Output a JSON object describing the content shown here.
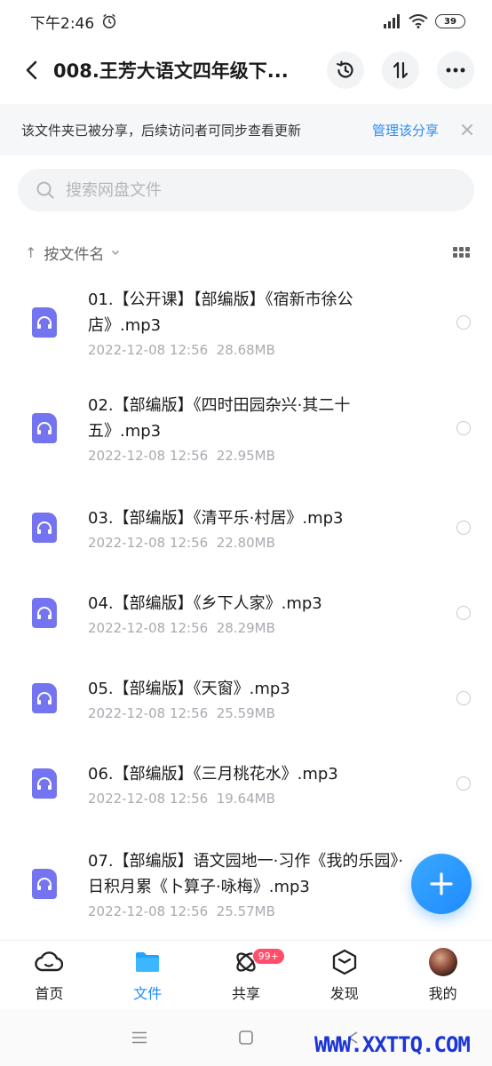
{
  "status_bar": {
    "time": "下午2:46",
    "battery": "39"
  },
  "header": {
    "title": "008.王芳大语文四年级下..."
  },
  "banner": {
    "text": "该文件夹已被分享，后续访问者可同步查看更新",
    "link": "管理该分享"
  },
  "search": {
    "placeholder": "搜索网盘文件"
  },
  "sort": {
    "arrow": "↑",
    "label": "按文件名"
  },
  "files": [
    {
      "name": "01.【公开课】【部编版】《宿新市徐公店》.mp3",
      "date": "2022-12-08  12:56",
      "size": "28.68MB"
    },
    {
      "name": "02.【部编版】《四时田园杂兴·其二十五》.mp3",
      "date": "2022-12-08  12:56",
      "size": "22.95MB"
    },
    {
      "name": "03.【部编版】《清平乐·村居》.mp3",
      "date": "2022-12-08  12:56",
      "size": "22.80MB"
    },
    {
      "name": "04.【部编版】《乡下人家》.mp3",
      "date": "2022-12-08  12:56",
      "size": "28.29MB"
    },
    {
      "name": "05.【部编版】《天窗》.mp3",
      "date": "2022-12-08  12:56",
      "size": "25.59MB"
    },
    {
      "name": "06.【部编版】《三月桃花水》.mp3",
      "date": "2022-12-08  12:56",
      "size": "19.64MB"
    },
    {
      "name": "07.【部编版】语文园地一·习作《我的乐园》·日积月累《卜算子·咏梅》.mp3",
      "date": "2022-12-08  12:56",
      "size": "25.57MB"
    }
  ],
  "nav": {
    "home": "首页",
    "files": "文件",
    "share": "共享",
    "share_badge": "99+",
    "discover": "发现",
    "me": "我的"
  },
  "watermark": "WWW.XXTTQ.COM",
  "colors": {
    "accent": "#1f8bff",
    "file_icon": "#7474f0",
    "badge": "#ff4d6a"
  }
}
